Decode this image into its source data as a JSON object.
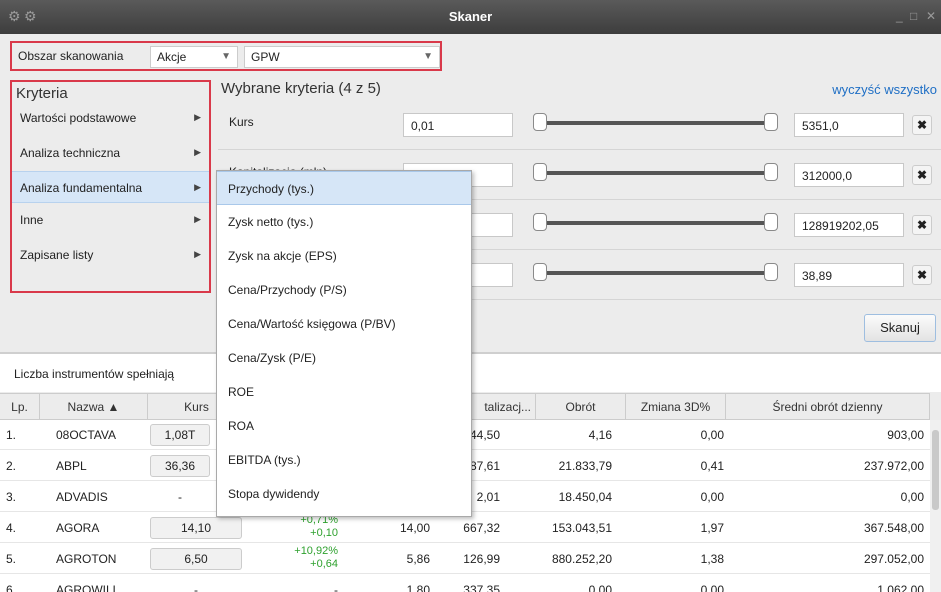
{
  "window": {
    "title": "Skaner",
    "min": "_",
    "max": "□",
    "close": "✕"
  },
  "scan": {
    "label": "Obszar skanowania",
    "type_value": "Akcje",
    "market_value": "GPW"
  },
  "criteria": {
    "header": "Kryteria",
    "items": [
      {
        "label": "Wartości podstawowe"
      },
      {
        "label": "Analiza techniczna"
      },
      {
        "label": "Analiza fundamentalna"
      },
      {
        "label": "Inne"
      },
      {
        "label": "Zapisane listy"
      }
    ]
  },
  "selected": {
    "header": "Wybrane kryteria (4 z 5)",
    "clear_all": "wyczyść wszystko",
    "rows": [
      {
        "name": "Kurs",
        "min": "0,01",
        "max": "5351,0"
      },
      {
        "name": "Kapitalizacja (mln)",
        "min": "",
        "max": "312000,0"
      },
      {
        "name": "",
        "min": "",
        "max": "128919202,05"
      },
      {
        "name": "",
        "min": "",
        "max": "38,89"
      }
    ],
    "scan_button": "Skanuj"
  },
  "count_label": "Liczba instrumentów spełniają",
  "table": {
    "columns": [
      "Lp.",
      "Nazwa ▲",
      "Kurs",
      "",
      "talizacj...",
      "Obrót",
      "Zmiana 3D%",
      "Średni obrót dzienny"
    ],
    "rows": [
      {
        "lp": "1.",
        "name": "08OCTAVA",
        "price": "1,08T",
        "chg_pct": "",
        "chg_abs": "",
        "c4": "",
        "cap": "44,50",
        "turnover": "4,16",
        "chg3d": "0,00",
        "avg": "903,00"
      },
      {
        "lp": "2.",
        "name": "ABPL",
        "price": "36,36",
        "chg_pct": "",
        "chg_abs": "",
        "c4": "",
        "cap": "587,61",
        "turnover": "21.833,79",
        "chg3d": "0,41",
        "avg": "237.972,00"
      },
      {
        "lp": "3.",
        "name": "ADVADIS",
        "price": "-",
        "chg_pct": "",
        "chg_abs": "",
        "c4": "",
        "cap": "2,01",
        "turnover": "18.450,04",
        "chg3d": "0,00",
        "avg": "0,00"
      },
      {
        "lp": "4.",
        "name": "AGORA",
        "price": "14,10",
        "chg_pct": "+0,71%",
        "chg_abs": "+0,10",
        "c4": "14,00",
        "cap": "667,32",
        "turnover": "153.043,51",
        "chg3d": "1,97",
        "avg": "367.548,00"
      },
      {
        "lp": "5.",
        "name": "AGROTON",
        "price": "6,50",
        "chg_pct": "+10,92%",
        "chg_abs": "+0,64",
        "c4": "5,86",
        "cap": "126,99",
        "turnover": "880.252,20",
        "chg3d": "1,38",
        "avg": "297.052,00"
      },
      {
        "lp": "6.",
        "name": "AGROWILL",
        "price": "-",
        "chg_pct": "-",
        "chg_abs": "",
        "c4": "1,80",
        "cap": "337,35",
        "turnover": "0,00",
        "chg3d": "0,00",
        "avg": "1.062,00"
      }
    ]
  },
  "submenu": {
    "items": [
      {
        "label": "Przychody (tys.)"
      },
      {
        "label": "Zysk netto (tys.)"
      },
      {
        "label": "Zysk na akcje (EPS)"
      },
      {
        "label": "Cena/Przychody (P/S)"
      },
      {
        "label": "Cena/Wartość księgowa (P/BV)"
      },
      {
        "label": "Cena/Zysk (P/E)"
      },
      {
        "label": "ROE"
      },
      {
        "label": "ROA"
      },
      {
        "label": "EBITDA (tys.)"
      },
      {
        "label": "Stopa dywidendy"
      }
    ]
  },
  "colors": {
    "accent_border": "#d9394a",
    "link": "#1f6fc5",
    "positive": "#2ea12e",
    "highlight": "#d6e6f7"
  }
}
